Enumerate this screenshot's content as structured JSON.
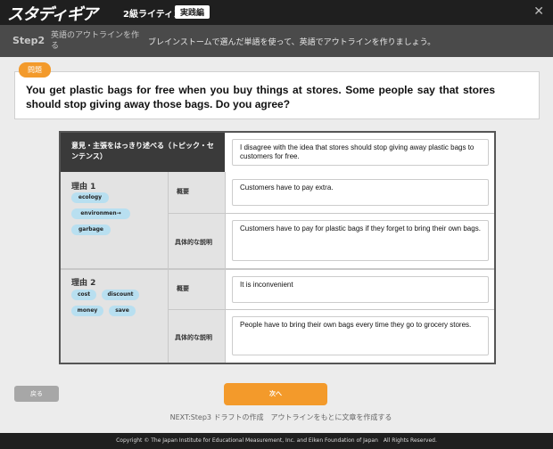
{
  "app": {
    "logo": "スタディギア",
    "title": "2級ライティング",
    "badge": "実践編"
  },
  "step": {
    "num": "Step2",
    "title": "英語のアウトラインを作る",
    "instruction": "ブレインストームで選んだ単語を使って、英語でアウトラインを作りましょう。"
  },
  "question": {
    "tab_label": "問題",
    "text": "You get plastic bags for free when you buy things at stores. Some people say that stores should stop giving away those bags. Do you agree?"
  },
  "outline": {
    "topic_label": "意見・主張をはっきり述べる（トピック・センテンス）",
    "topic_value": "I disagree with the idea that stores should stop giving away plastic bags to customers for free.",
    "reasons": [
      {
        "title": "理由 1",
        "keywords": [
          "ecology",
          "environmen→",
          "garbage"
        ],
        "summary_label": "概要",
        "summary_value": "Customers have to pay extra.",
        "detail_label": "具体的な説明",
        "detail_value": "Customers have to pay for plastic bags if they forget to bring their own bags."
      },
      {
        "title": "理由 2",
        "keywords": [
          "cost",
          "discount",
          "money",
          "save"
        ],
        "summary_label": "概要",
        "summary_value": "It is inconvenient",
        "detail_label": "具体的な説明",
        "detail_value": "People have to bring their own bags every time they go to grocery stores."
      }
    ]
  },
  "nav": {
    "back_label": "戻る",
    "next_label": "次へ",
    "next_note": "NEXT:Step3 ドラフトの作成　アウトラインをもとに文章を作成する"
  },
  "footer": {
    "copyright": "Copyright © The Japan Institute for Educational Measurement, Inc. and Eiken Foundation of Japan　All Rights Reserved."
  }
}
